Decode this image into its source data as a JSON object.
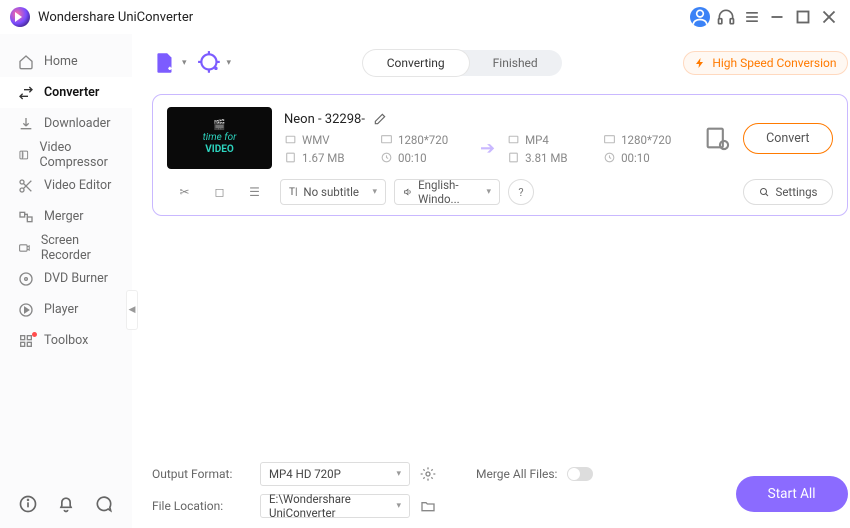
{
  "app": {
    "title": "Wondershare UniConverter"
  },
  "sidebar": {
    "items": [
      {
        "label": "Home"
      },
      {
        "label": "Converter"
      },
      {
        "label": "Downloader"
      },
      {
        "label": "Video Compressor"
      },
      {
        "label": "Video Editor"
      },
      {
        "label": "Merger"
      },
      {
        "label": "Screen Recorder"
      },
      {
        "label": "DVD Burner"
      },
      {
        "label": "Player"
      },
      {
        "label": "Toolbox"
      }
    ]
  },
  "tabs": {
    "converting": "Converting",
    "finished": "Finished"
  },
  "highspeed": "High Speed Conversion",
  "file": {
    "name": "Neon - 32298-",
    "src": {
      "format": "WMV",
      "res": "1280*720",
      "size": "1.67 MB",
      "dur": "00:10"
    },
    "dst": {
      "format": "MP4",
      "res": "1280*720",
      "size": "3.81 MB",
      "dur": "00:10"
    },
    "convert": "Convert",
    "subtitle": "No subtitle",
    "audio": "English-Windo...",
    "settings": "Settings"
  },
  "footer": {
    "outputFormatLabel": "Output Format:",
    "outputFormat": "MP4 HD 720P",
    "mergeLabel": "Merge All Files:",
    "fileLocationLabel": "File Location:",
    "fileLocation": "E:\\Wondershare UniConverter",
    "startAll": "Start All"
  }
}
